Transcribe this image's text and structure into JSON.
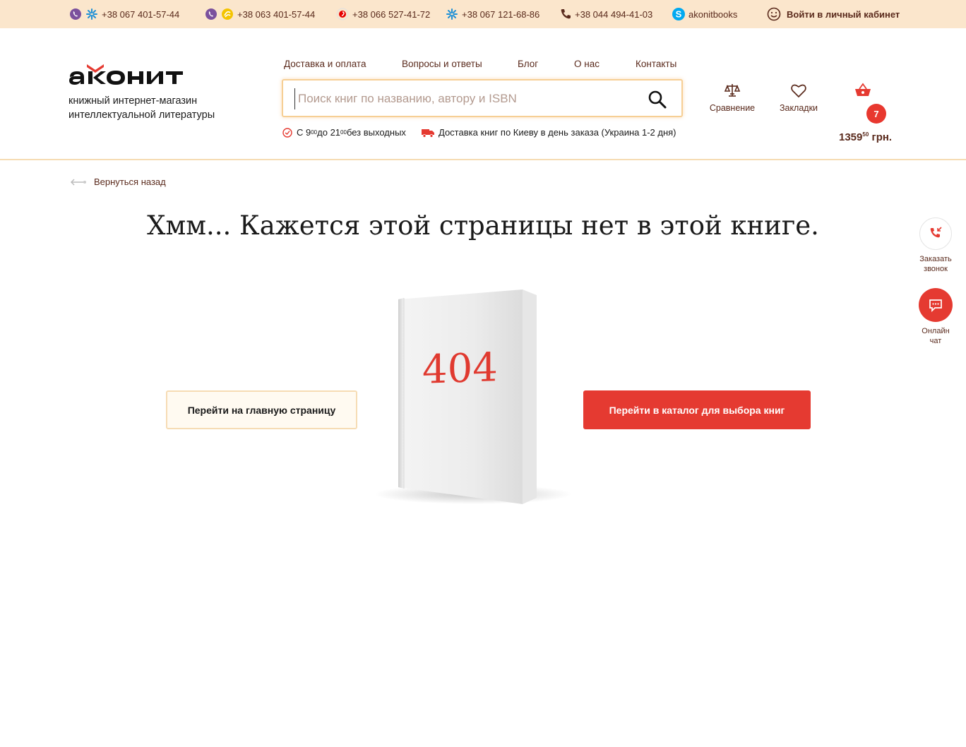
{
  "topbar": {
    "phones": [
      {
        "number": "+38 067 401-57-44"
      },
      {
        "number": "+38 063 401-57-44"
      },
      {
        "number": "+38 066 527-41-72"
      },
      {
        "number": "+38 067 121-68-86"
      },
      {
        "number": "+38 044 494-41-03"
      }
    ],
    "skype": "akonitbooks",
    "login": "Войти в личный кабинет"
  },
  "logo": {
    "tagline_line1": "книжный интернет-магазин",
    "tagline_line2": "интеллектуальной литературы"
  },
  "nav": {
    "items": [
      "Доставка и оплата",
      "Вопросы и ответы",
      "Блог",
      "О нас",
      "Контакты"
    ]
  },
  "search": {
    "placeholder": "Поиск книг по названию, автору и ISBN"
  },
  "info": {
    "hours_prefix": "С 9",
    "hours_from_min": "00",
    "hours_mid": " до 21",
    "hours_to_min": "00",
    "hours_suffix": " без выходных",
    "delivery": "Доставка книг по Киеву в день заказа (Украина 1-2 дня)"
  },
  "header_actions": {
    "compare": "Сравнение",
    "bookmarks": "Закладки",
    "cart_count": "7",
    "cart_sum": "1359",
    "cart_cents": "50",
    "cart_currency": " грн."
  },
  "page": {
    "back": "Вернуться назад",
    "title": "Хмм... Кажется этой страницы нет в этой книге.",
    "code": "404",
    "btn_home": "Перейти на главную страницу",
    "btn_catalog": "Перейти в каталог для выбора книг"
  },
  "side": {
    "callback_line1": "Заказать",
    "callback_line2": "звонок",
    "chat_line1": "Онлайн",
    "chat_line2": "чат"
  },
  "colors": {
    "topbar_bg": "#fbe6cc",
    "accent_red": "#e53a31",
    "text_brown": "#5a2a1c"
  }
}
